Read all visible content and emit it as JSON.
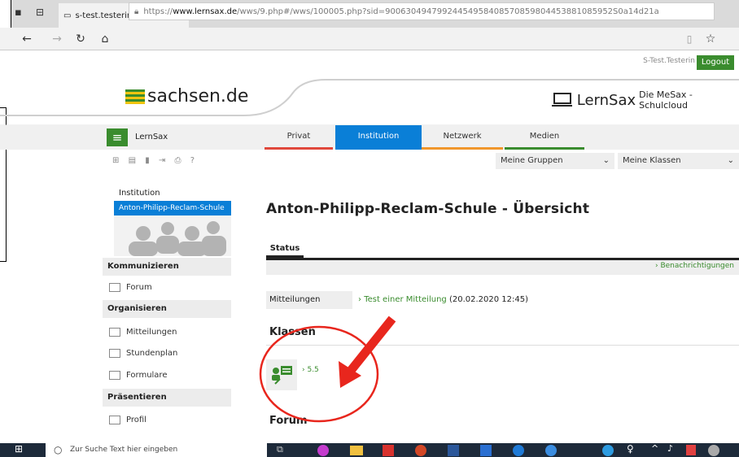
{
  "browser": {
    "tab_title": "s-test.testerin@reclam.l",
    "url_prefix": "https://",
    "url_domain": "www.lernsax.de",
    "url_rest": "/wws/9.php#/wws/100005.php?sid=90063049479924454958408570859804453881085952S0a14d21a"
  },
  "header": {
    "user": "S-Test.Testerin",
    "logout_label": "Logout",
    "left_logo": "sachsen.de",
    "right_logo": "LernSax",
    "right_sub": "Die MeSax - Schulcloud"
  },
  "nav": {
    "app_name": "LernSax",
    "tabs": [
      {
        "label": "Privat",
        "color": "#e0483c"
      },
      {
        "label": "Institution",
        "color": "#0a7fd7"
      },
      {
        "label": "Netzwerk",
        "color": "#f0962c"
      },
      {
        "label": "Medien",
        "color": "#3a8c2e"
      }
    ],
    "select_groups": "Meine Gruppen",
    "select_classes": "Meine Klassen"
  },
  "sidebar": {
    "title": "Institution",
    "school": "Anton-Philipp-Reclam-Schule",
    "sections": [
      {
        "heading": "Kommunizieren",
        "items": [
          "Forum"
        ]
      },
      {
        "heading": "Organisieren",
        "items": [
          "Mitteilungen",
          "Stundenplan",
          "Formulare"
        ]
      },
      {
        "heading": "Präsentieren",
        "items": [
          "Profil"
        ]
      }
    ]
  },
  "main": {
    "title": "Anton-Philipp-Reclam-Schule - Übersicht",
    "status_tab": "Status",
    "notifications_link": "Benachrichtigungen",
    "mitteilungen_label": "Mitteilungen",
    "mitteilung_link": "Test einer Mitteilung",
    "mitteilung_date": "(20.02.2020 12:45)",
    "klassen_heading": "Klassen",
    "class_link": "5.5",
    "forum_heading": "Forum"
  },
  "taskbar": {
    "search_placeholder": "Zur Suche Text hier eingeben"
  },
  "colors": {
    "accent_blue": "#0a7fd7",
    "accent_green": "#3a8c2e",
    "annotation_red": "#e8261d"
  }
}
